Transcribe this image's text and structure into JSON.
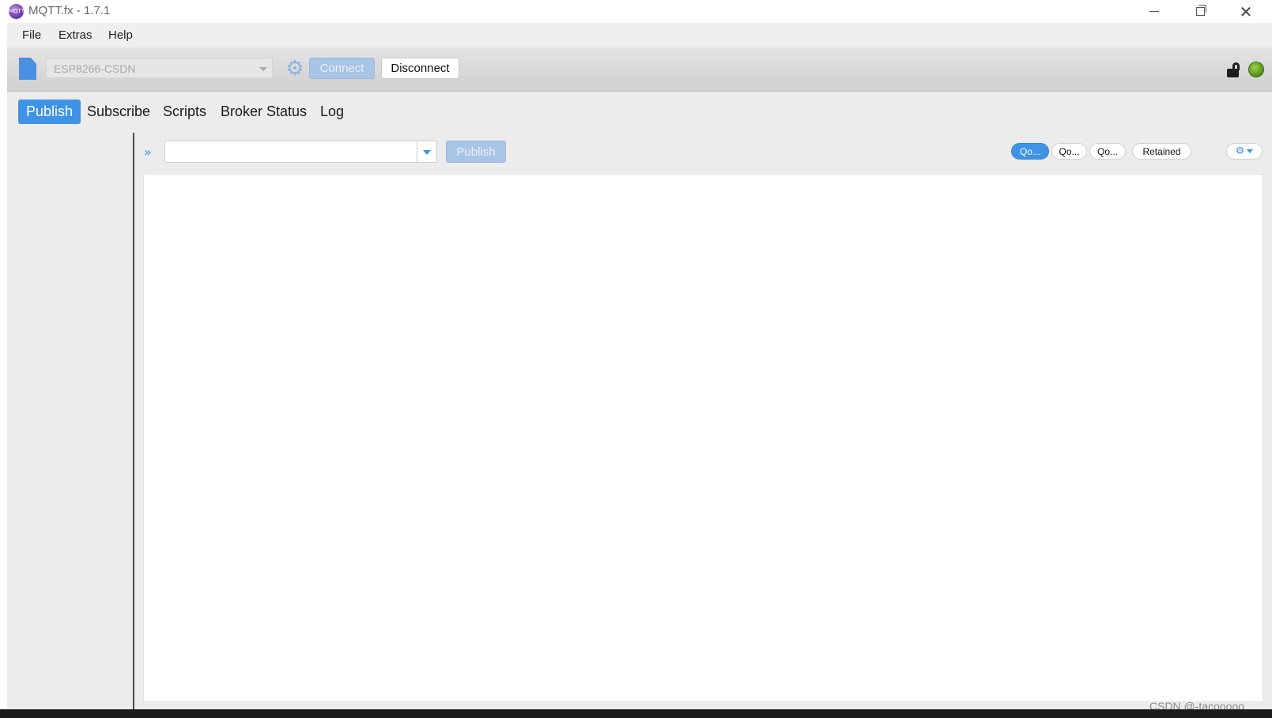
{
  "window": {
    "title": "MQTT.fx - 1.7.1",
    "app_icon_text": "MQTT"
  },
  "menu": {
    "items": [
      "File",
      "Extras",
      "Help"
    ]
  },
  "toolbar": {
    "profile_value": "ESP8266-CSDN",
    "connect_label": "Connect",
    "disconnect_label": "Disconnect",
    "connection_status_color": "#6fb02b"
  },
  "tabs": {
    "items": [
      "Publish",
      "Subscribe",
      "Scripts",
      "Broker Status",
      "Log"
    ],
    "active": "Publish"
  },
  "publish": {
    "topic_value": "",
    "publish_label": "Publish",
    "qos0_label": "Qo...",
    "qos1_label": "Qo...",
    "qos2_label": "Qo...",
    "retained_label": "Retained",
    "payload": ""
  },
  "watermark": "CSDN @-tacooooo",
  "colors": {
    "accent": "#3e93e6",
    "disabled_button": "#a8c4e6"
  }
}
